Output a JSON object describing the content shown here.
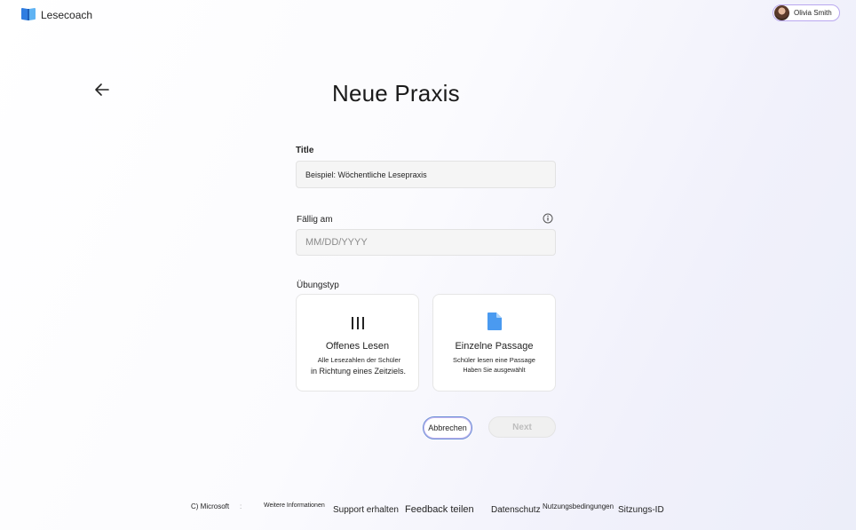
{
  "header": {
    "app_name": "Lesecoach",
    "user": {
      "name": "Olivia Smith"
    }
  },
  "page": {
    "title": "Neue Praxis"
  },
  "form": {
    "title_label": "Title",
    "title_value": "Beispiel: Wöchentliche Lesepraxis",
    "due_label": "Fällig am",
    "due_placeholder": "MM/DD/YYYY",
    "type_label": "Übungstyp",
    "types": [
      {
        "title": "Offenes Lesen",
        "desc_line1": "Alle Lesezahlen der Schüler",
        "desc_line2": "in Richtung eines Zeitziels.",
        "icon": "reading-lines-icon"
      },
      {
        "title": "Einzelne Passage",
        "desc_line1": "Schüler lesen eine Passage",
        "desc_line2": "Haben Sie ausgewählt",
        "icon": "document-icon"
      }
    ]
  },
  "buttons": {
    "cancel_label": "Abbrechen",
    "next_label": "Next"
  },
  "footer": {
    "copyright": "C) Microsoft",
    "separator": ":",
    "more_info": "Weitere Informationen",
    "support": "Support erhalten",
    "feedback": "Feedback teilen",
    "privacy": "Datenschutz",
    "terms": "Nutzungsbedingungen",
    "session_id": "Sitzungs-ID"
  },
  "colors": {
    "accent_border": "#6b8fd6",
    "pill_border": "#b9a7ef",
    "logo_blue": "#2f7de1",
    "logo_light": "#5fb3f3",
    "doc_icon": "#4a9af0"
  }
}
